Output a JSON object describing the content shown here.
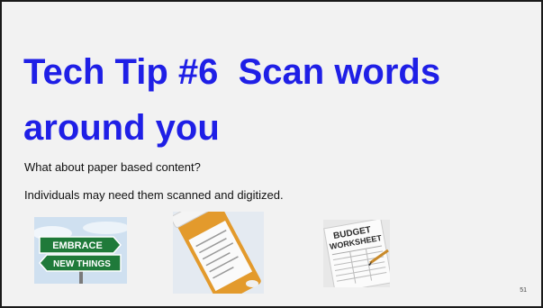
{
  "slide": {
    "title_line1": "Tech Tip #6  Scan words",
    "title_line2": "around you",
    "body_line1": "What about paper based content?",
    "body_line2": "Individuals may need them scanned and digitized.",
    "page_number": "51"
  },
  "images": {
    "embrace_sign": {
      "top_text": "EMBRACE",
      "bottom_text": "NEW THINGS"
    },
    "pill_bottle": {},
    "budget_worksheet": {
      "line1": "BUDGET",
      "line2": "WORKSHEET"
    }
  },
  "colors": {
    "title": "#1f1fe6",
    "slide_background": "#f2f2f2",
    "border": "#1a1a1a",
    "sign_green": "#1f7a3a"
  }
}
